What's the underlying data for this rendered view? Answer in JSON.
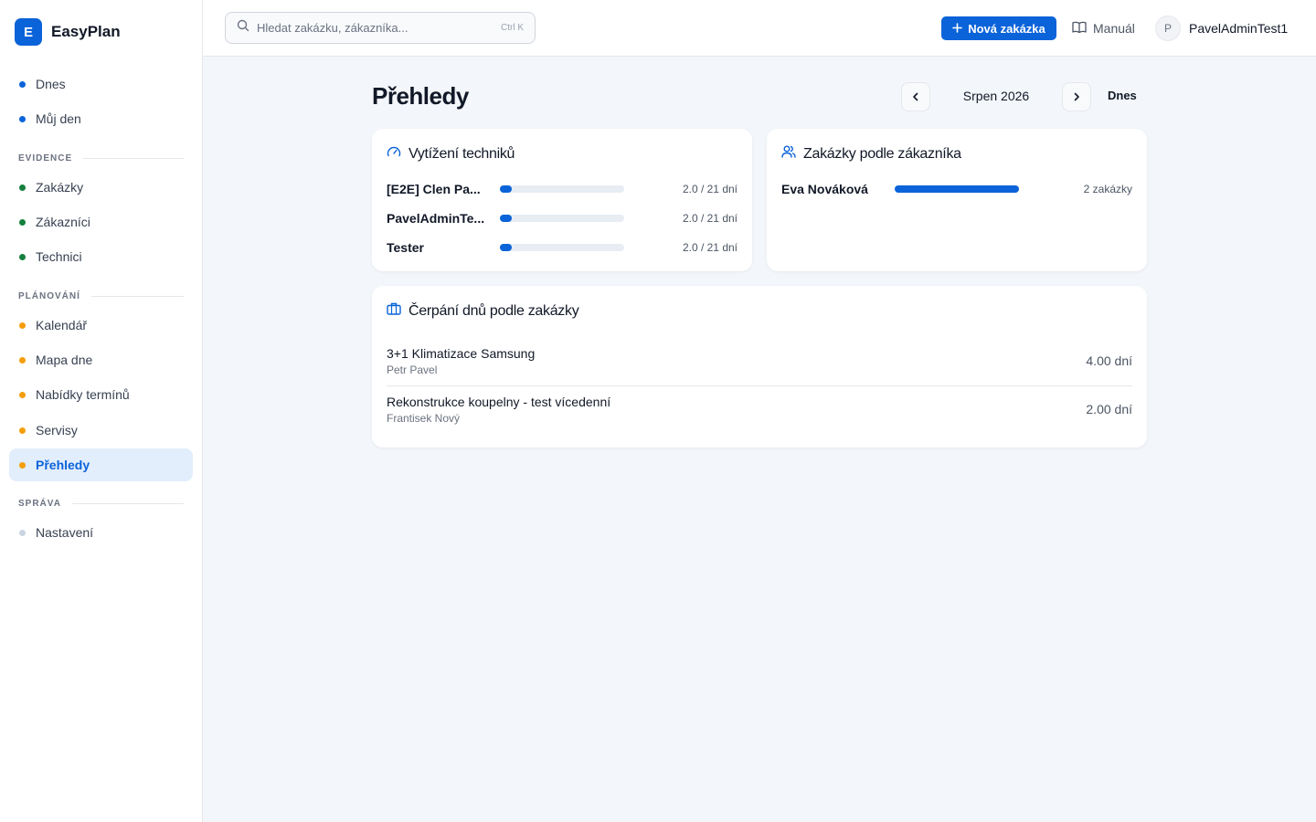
{
  "app": {
    "logo_letter": "E",
    "name": "EasyPlan"
  },
  "colors": {
    "accent": "#0b63d9",
    "dot_blue": "#0b63d9",
    "dot_green": "#15803d",
    "dot_orange": "#f59e0b",
    "dot_gray": "#cbd5e1"
  },
  "sidebar": {
    "items_top": [
      {
        "label": "Dnes",
        "dot": "#0b63d9"
      },
      {
        "label": "Můj den",
        "dot": "#0b63d9"
      }
    ],
    "sections": [
      {
        "title": "EVIDENCE",
        "items": [
          {
            "label": "Zakázky",
            "dot": "#15803d"
          },
          {
            "label": "Zákazníci",
            "dot": "#15803d"
          },
          {
            "label": "Technici",
            "dot": "#15803d"
          }
        ]
      },
      {
        "title": "PLÁNOVÁNÍ",
        "items": [
          {
            "label": "Kalendář",
            "dot": "#f59e0b"
          },
          {
            "label": "Mapa dne",
            "dot": "#f59e0b"
          },
          {
            "label": "Nabídky termínů",
            "dot": "#f59e0b"
          },
          {
            "label": "Servisy",
            "dot": "#f59e0b"
          },
          {
            "label": "Přehledy",
            "dot": "#f59e0b",
            "active": true
          }
        ]
      },
      {
        "title": "SPRÁVA",
        "items": [
          {
            "label": "Nastavení",
            "dot": "#cbd5e1"
          }
        ]
      }
    ]
  },
  "header": {
    "search_placeholder": "Hledat zakázku, zákazníka...",
    "search_shortcut": "Ctrl K",
    "new_order_label": "Nová zakázka",
    "manual_label": "Manuál",
    "user_initial": "P",
    "user_name": "PavelAdminTest1"
  },
  "main": {
    "title": "Přehledy",
    "month": "Srpen 2026",
    "today_label": "Dnes",
    "tech_card": {
      "title": "Vytížení techniků",
      "rows": [
        {
          "name": "[E2E] Clen Pa...",
          "value": "2.0 / 21 dní",
          "fraction": 0.095
        },
        {
          "name": "PavelAdminTe...",
          "value": "2.0 / 21 dní",
          "fraction": 0.095
        },
        {
          "name": "Tester",
          "value": "2.0 / 21 dní",
          "fraction": 0.095
        }
      ]
    },
    "customer_card": {
      "title": "Zakázky podle zákazníka",
      "rows": [
        {
          "name": "Eva Nováková",
          "value": "2 zakázky",
          "fraction": 1.0
        }
      ]
    },
    "orders_card": {
      "title": "Čerpání dnů podle zakázky",
      "rows": [
        {
          "name": "3+1 Klimatizace Samsung",
          "customer": "Petr Pavel",
          "days": "4.00 dní"
        },
        {
          "name": "Rekonstrukce koupelny - test vícedenní",
          "customer": "Frantisek Nový",
          "days": "2.00 dní"
        }
      ]
    }
  }
}
